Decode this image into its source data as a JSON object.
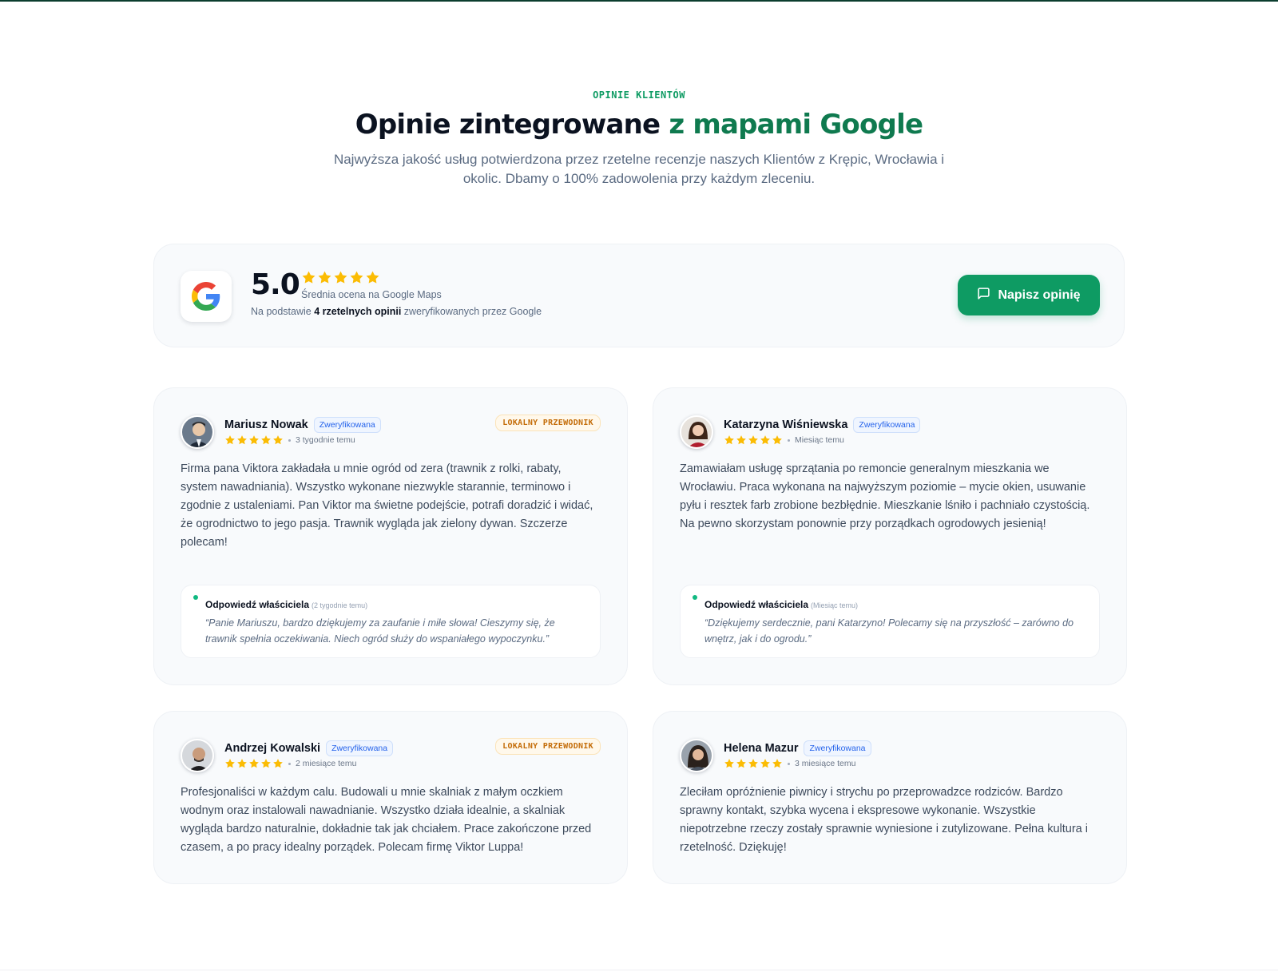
{
  "header": {
    "eyebrow": "OPINIE KLIENTÓW",
    "title_main": "Opinie zintegrowane",
    "title_accent": "z mapami Google",
    "subtitle": "Najwyższa jakość usług potwierdzona przez rzetelne recenzje naszych Klientów z Krępic, Wrocławia i okolic. Dbamy o 100% zadowolenia przy każdym zleceniu."
  },
  "summary": {
    "logo_icon": "google-g-icon",
    "score": "5.0",
    "stars": 5,
    "caption": "Średnia ocena na Google Maps",
    "basis_prefix": "Na podstawie",
    "basis_bold": "4 rzetelnych opinii",
    "basis_suffix": "zweryfikowanych przez Google",
    "button_label": "Napisz opinię",
    "button_icon": "message-square-icon"
  },
  "colors": {
    "accent": "#0e9b63",
    "accent_dark": "#0f7a4f",
    "star": "#fbbc04",
    "verified": "#2563eb",
    "guide": "#c46d09"
  },
  "reviews": [
    {
      "name": "Mariusz Nowak",
      "verified": "Zweryfikowana",
      "stars": 5,
      "when": "3 tygodnie temu",
      "badge": "LOKALNY PRZEWODNIK",
      "text": "Firma pana Viktora zakładała u mnie ogród od zera (trawnik z rolki, rabaty, system nawadniania). Wszystko wykonane niezwykle starannie, terminowo i zgodnie z ustaleniami. Pan Viktor ma świetne podejście, potrafi doradzić i widać, że ogrodnictwo to jego pasja. Trawnik wygląda jak zielony dywan. Szczerze polecam!",
      "reply_title": "Odpowiedź właściciela",
      "reply_when": "(2 tygodnie temu)",
      "reply_text": "“Panie Mariuszu, bardzo dziękujemy za zaufanie i miłe słowa! Cieszymy się, że trawnik spełnia oczekiwania. Niech ogród służy do wspaniałego wypoczynku.”"
    },
    {
      "name": "Katarzyna Wiśniewska",
      "verified": "Zweryfikowana",
      "stars": 5,
      "when": "Miesiąc temu",
      "text": "Zamawiałam usługę sprzątania po remoncie generalnym mieszkania we Wrocławiu. Praca wykonana na najwyższym poziomie – mycie okien, usuwanie pyłu i resztek farb zrobione bezbłędnie. Mieszkanie lśniło i pachniało czystością. Na pewno skorzystam ponownie przy porządkach ogrodowych jesienią!",
      "reply_title": "Odpowiedź właściciela",
      "reply_when": "(Miesiąc temu)",
      "reply_text": "“Dziękujemy serdecznie, pani Katarzyno! Polecamy się na przyszłość – zarówno do wnętrz, jak i do ogrodu.”"
    },
    {
      "name": "Andrzej Kowalski",
      "verified": "Zweryfikowana",
      "stars": 5,
      "when": "2 miesiące temu",
      "badge": "LOKALNY PRZEWODNIK",
      "text": "Profesjonaliści w każdym calu. Budowali u mnie skalniak z małym oczkiem wodnym oraz instalowali nawadnianie. Wszystko działa idealnie, a skalniak wygląda bardzo naturalnie, dokładnie tak jak chciałem. Prace zakończone przed czasem, a po pracy idealny porządek. Polecam firmę Viktor Luppa!"
    },
    {
      "name": "Helena Mazur",
      "verified": "Zweryfikowana",
      "stars": 5,
      "when": "3 miesiące temu",
      "text": "Zleciłam opróżnienie piwnicy i strychu po przeprowadzce rodziców. Bardzo sprawny kontakt, szybka wycena i ekspresowe wykonanie. Wszystkie niepotrzebne rzeczy zostały sprawnie wyniesione i zutylizowane. Pełna kultura i rzetelność. Dziękuję!"
    }
  ]
}
